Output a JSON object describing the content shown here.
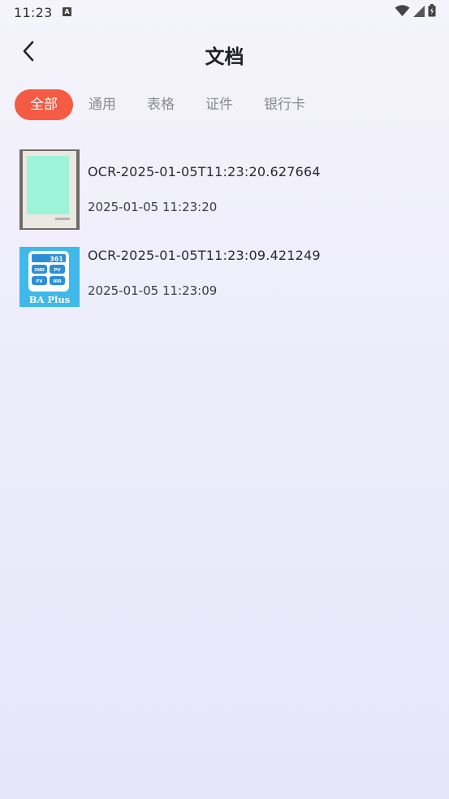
{
  "status_bar": {
    "time": "11:23",
    "notification_icon": "a-letter-icon",
    "icons": [
      "wifi-icon",
      "cell-signal-icon",
      "battery-icon"
    ]
  },
  "header": {
    "back_icon": "chevron-left-icon",
    "title": "文档"
  },
  "tabs": [
    {
      "label": "全部",
      "active": true
    },
    {
      "label": "通用",
      "active": false
    },
    {
      "label": "表格",
      "active": false
    },
    {
      "label": "证件",
      "active": false
    },
    {
      "label": "银行卡",
      "active": false
    }
  ],
  "documents": [
    {
      "name": "OCR-2025-01-05T11:23:20.627664",
      "date": "2025-01-05 11:23:20",
      "thumbnail": "scanned-card-thumbnail"
    },
    {
      "name": "OCR-2025-01-05T11:23:09.421249",
      "date": "2025-01-05 11:23:09",
      "thumbnail": "ba-plus-app-thumbnail",
      "thumbnail_text": {
        "number": "361",
        "keys": [
          "2ND",
          "PV",
          "FV",
          "IRR"
        ],
        "caption": "BA Plus"
      }
    }
  ],
  "colors": {
    "accent": "#f55a43",
    "thumbnail_blue": "#3fb8ea",
    "thumbnail_mint": "#9ef3d8"
  }
}
